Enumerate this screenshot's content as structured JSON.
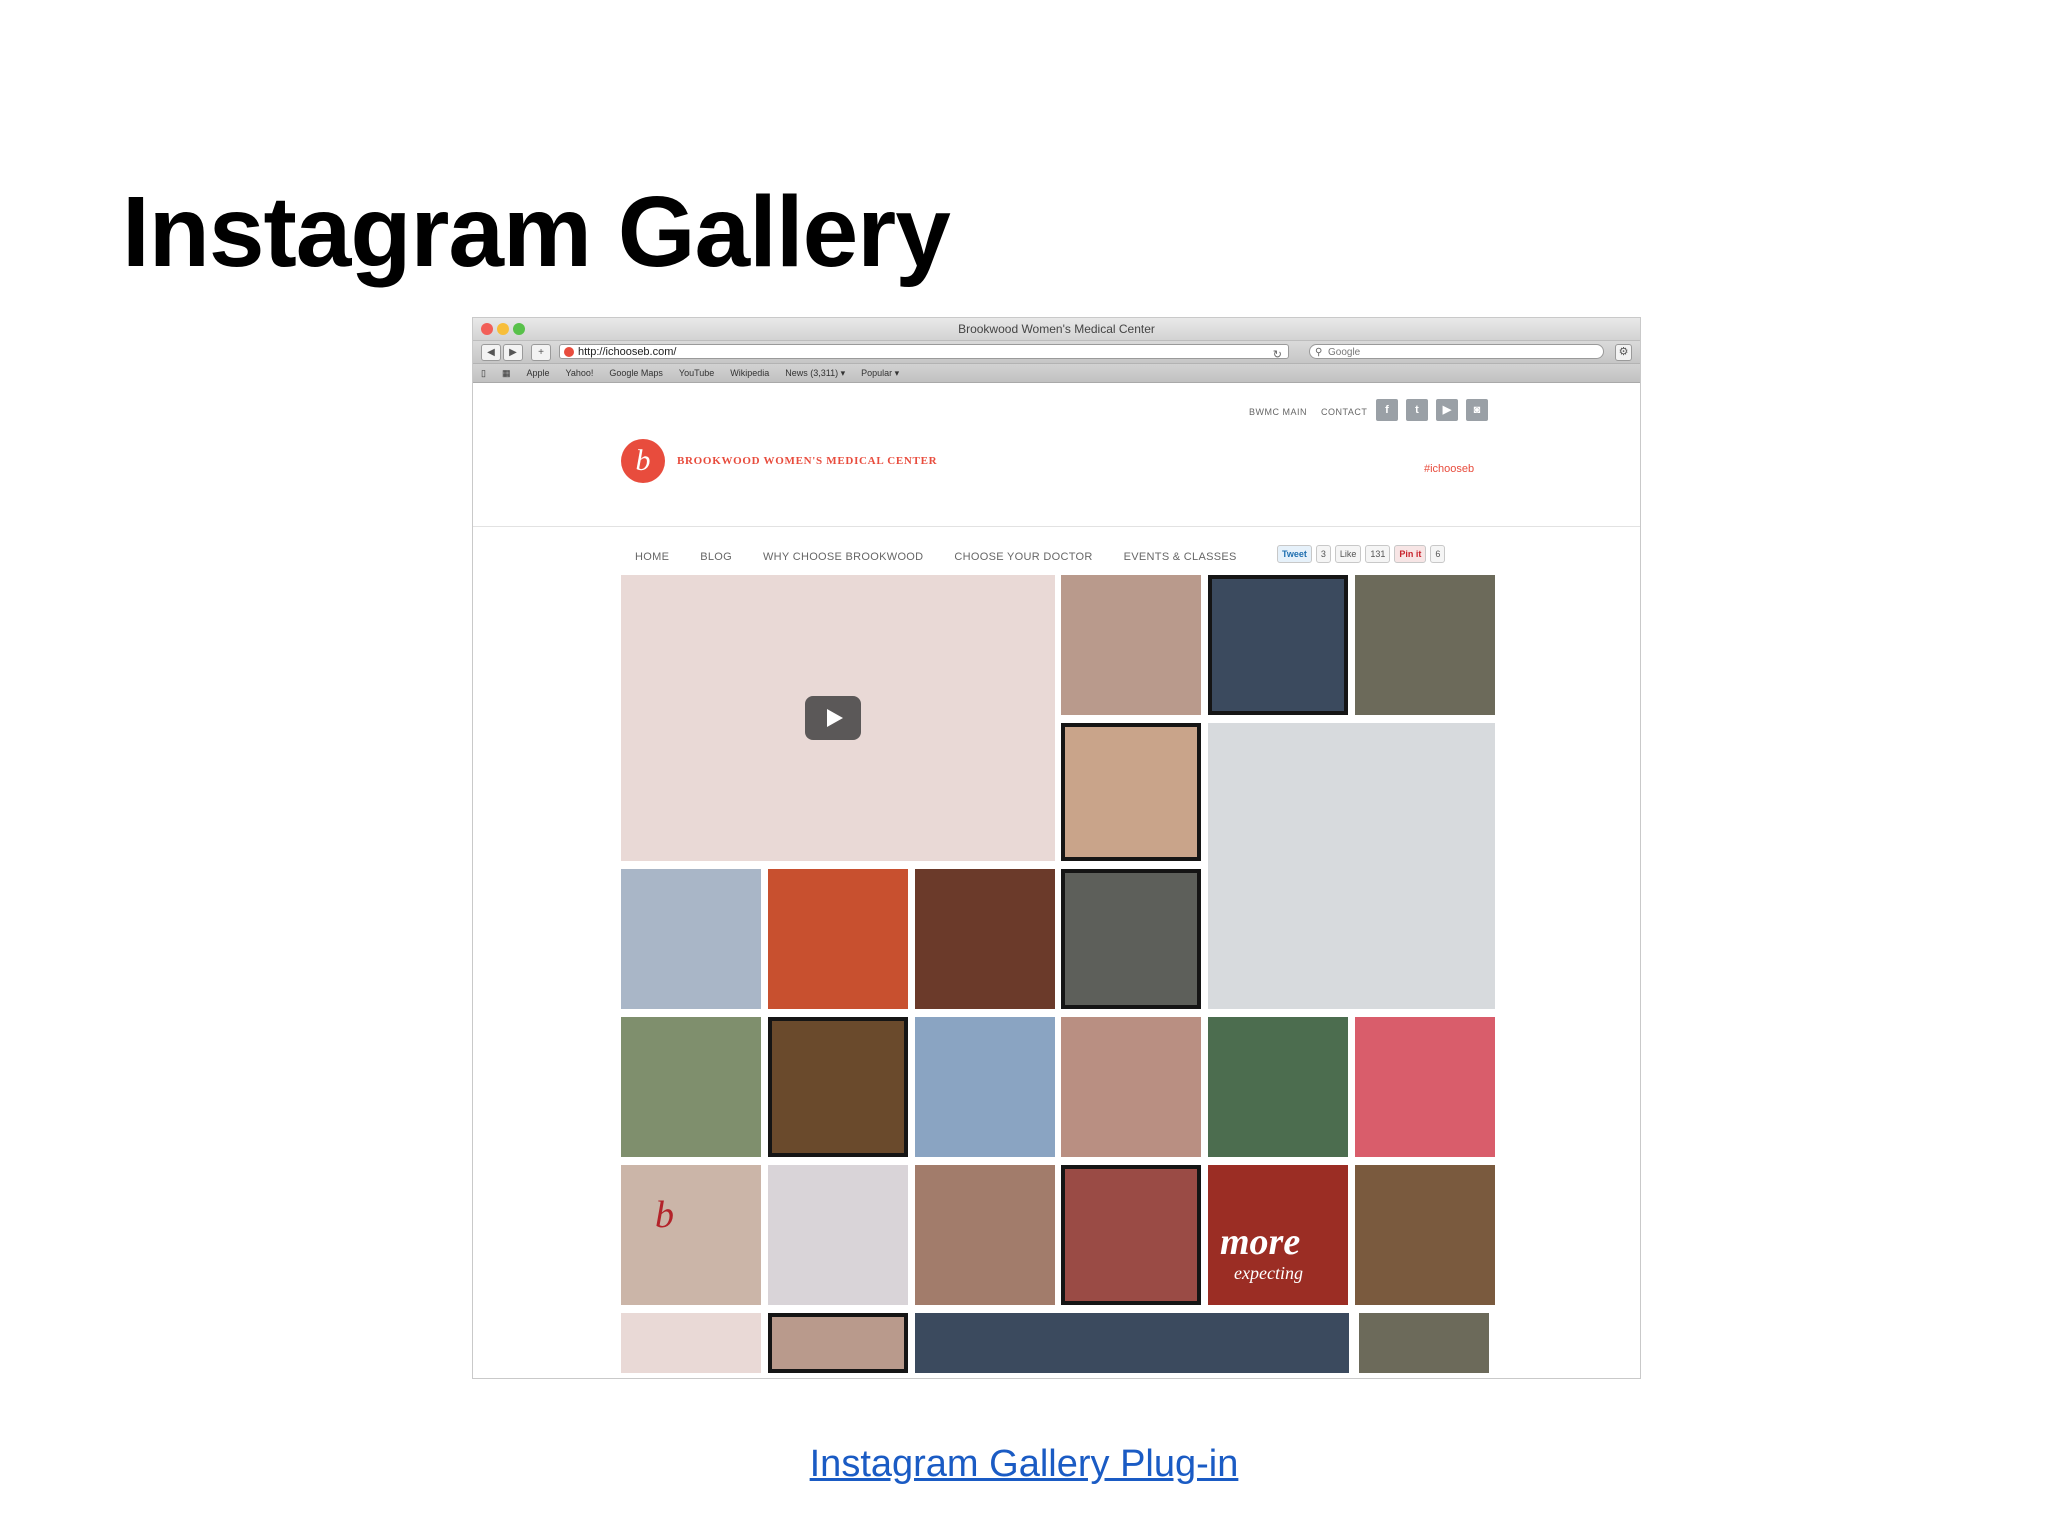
{
  "slide": {
    "title": "Instagram Gallery",
    "link_text": "Instagram Gallery Plug-in"
  },
  "browser": {
    "window_title": "Brookwood Women's Medical Center",
    "url": "http://ichooseb.com/",
    "search_placeholder": "Google",
    "back_label": "◀",
    "forward_label": "▶",
    "add_label": "+",
    "bookmarks": [
      "Apple",
      "Yahoo!",
      "Google Maps",
      "YouTube",
      "Wikipedia",
      "News (3,311) ▾",
      "Popular ▾"
    ]
  },
  "site": {
    "header_links": [
      "BWMC MAIN",
      "CONTACT"
    ],
    "social_icons": [
      "facebook-icon",
      "twitter-icon",
      "youtube-icon",
      "instagram-icon"
    ],
    "logo_letter": "b",
    "logo_text": "BROOKWOOD WOMEN'S MEDICAL CENTER",
    "hashtag": "#ichooseb",
    "nav": [
      "HOME",
      "BLOG",
      "WHY CHOOSE BROOKWOOD",
      "CHOOSE YOUR DOCTOR",
      "EVENTS & CLASSES"
    ],
    "share": {
      "tweet_label": "Tweet",
      "tweet_count": "3",
      "like_label": "Like",
      "like_count": "131",
      "pin_label": "Pin it",
      "pin_count": "6"
    },
    "tile_texts": {
      "letter_b": "b",
      "more": "more",
      "expecting": "expecting"
    },
    "tile_colors": [
      "#e9d9d6",
      "#b99a8c",
      "#3b4a5e",
      "#6c6a5a",
      "#c9a48a",
      "#d7dadd",
      "#a9b6c7",
      "#c8502f",
      "#6b3a2a",
      "#5d5f5a",
      "#7f8f6d",
      "#6a4a2c",
      "#8aa4c2",
      "#b98f82",
      "#4c6d4f",
      "#d95d6b",
      "#cbb5a8",
      "#d9d4d8",
      "#a27c6b",
      "#9a4b45",
      "#9b2d24",
      "#7a5a3e"
    ]
  }
}
